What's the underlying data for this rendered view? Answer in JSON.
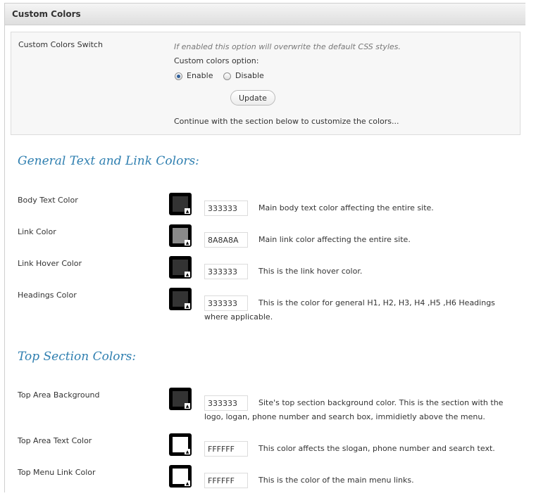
{
  "panel": {
    "title": "Custom Colors"
  },
  "switch": {
    "label": "Custom Colors Switch",
    "note": "If enabled this option will overwrite the default CSS styles.",
    "option_label": "Custom colors option:",
    "enable_label": "Enable",
    "disable_label": "Disable",
    "selected": "Enable",
    "update_label": "Update",
    "continue_text": "Continue with the section below to customize the colors..."
  },
  "sections": {
    "general": "General Text and Link Colors:",
    "top": "Top Section Colors:"
  },
  "colors": {
    "body_text": {
      "label": "Body Text Color",
      "value": "333333",
      "swatch": "#333333",
      "desc": "Main body text color affecting the entire site."
    },
    "link": {
      "label": "Link Color",
      "value": "8A8A8A",
      "swatch": "#8A8A8A",
      "desc": "Main link color affecting the entire site."
    },
    "link_hover": {
      "label": "Link Hover Color",
      "value": "333333",
      "swatch": "#333333",
      "desc": "This is the link hover color."
    },
    "headings": {
      "label": "Headings Color",
      "value": "333333",
      "swatch": "#333333",
      "desc": "This is the color for general H1, H2, H3, H4 ,H5 ,H6 Headings where applicable."
    },
    "top_bg": {
      "label": "Top Area Background",
      "value": "333333",
      "swatch": "#333333",
      "desc": "Site's top section background color. This is the section with the logo, logan, phone number and search box, immidietly above the menu."
    },
    "top_text": {
      "label": "Top Area Text Color",
      "value": "FFFFFF",
      "swatch": "#FFFFFF",
      "desc": "This color affects the slogan, phone number and search text."
    },
    "top_menu_link": {
      "label": "Top Menu Link Color",
      "value": "FFFFFF",
      "swatch": "#FFFFFF",
      "desc": "This is the color of the main menu links."
    }
  },
  "theme": {
    "heading_color": "#2f7fb0",
    "radio_color": "#2f5f9a"
  }
}
